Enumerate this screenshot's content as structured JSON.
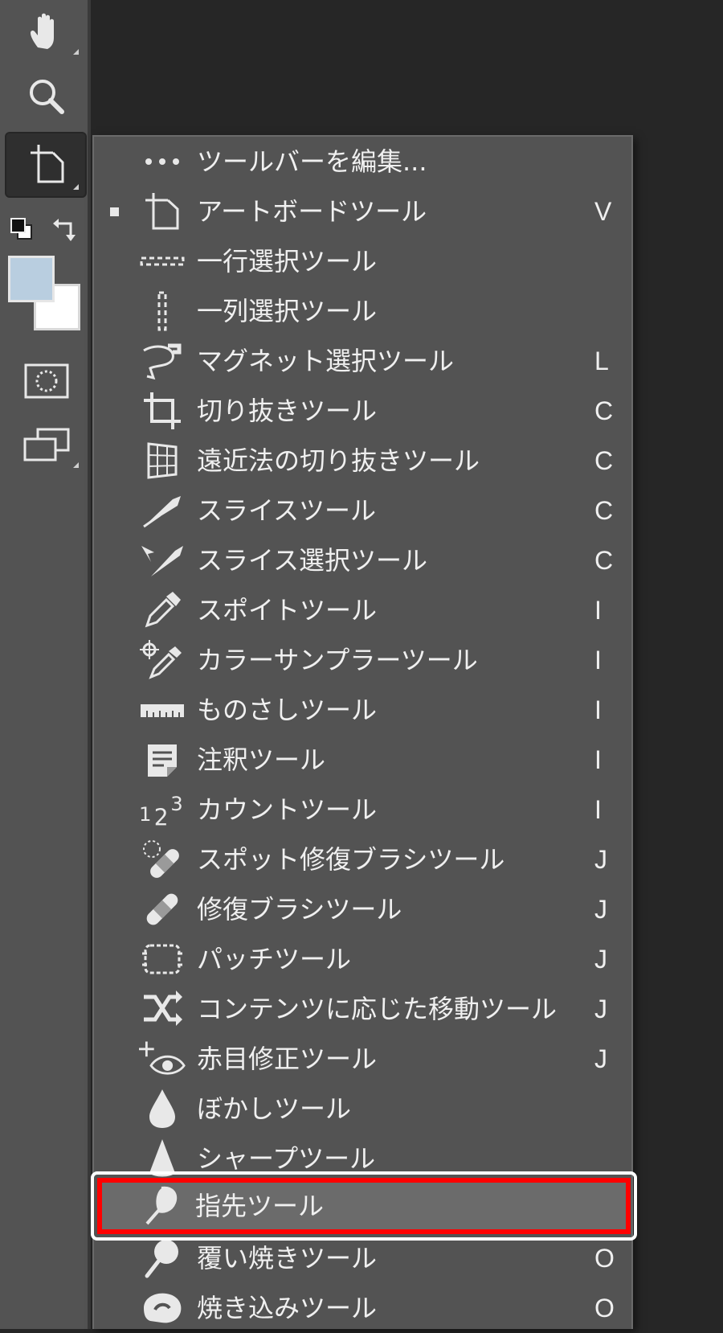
{
  "toolbar": {
    "tools": [
      {
        "name": "hand-tool",
        "icon": "hand-icon"
      },
      {
        "name": "zoom-tool",
        "icon": "magnifier-icon"
      },
      {
        "name": "artboard-tool",
        "icon": "artboard-icon",
        "active": true
      }
    ],
    "fg_color": "#b9cee0",
    "bg_color": "#ffffff"
  },
  "menu": {
    "items": [
      {
        "label": "ツールバーを編集...",
        "shortcut": "",
        "icon": "more-dots-icon",
        "selected": false
      },
      {
        "label": "アートボードツール",
        "shortcut": "V",
        "icon": "artboard-icon",
        "selected": true
      },
      {
        "label": "一行選択ツール",
        "shortcut": "",
        "icon": "single-row-marquee-icon",
        "selected": false
      },
      {
        "label": "一列選択ツール",
        "shortcut": "",
        "icon": "single-column-marquee-icon",
        "selected": false
      },
      {
        "label": "マグネット選択ツール",
        "shortcut": "L",
        "icon": "magnetic-lasso-icon",
        "selected": false
      },
      {
        "label": "切り抜きツール",
        "shortcut": "C",
        "icon": "crop-icon",
        "selected": false
      },
      {
        "label": "遠近法の切り抜きツール",
        "shortcut": "C",
        "icon": "perspective-crop-icon",
        "selected": false
      },
      {
        "label": "スライスツール",
        "shortcut": "C",
        "icon": "slice-icon",
        "selected": false
      },
      {
        "label": "スライス選択ツール",
        "shortcut": "C",
        "icon": "slice-select-icon",
        "selected": false
      },
      {
        "label": "スポイトツール",
        "shortcut": "I",
        "icon": "eyedropper-icon",
        "selected": false
      },
      {
        "label": "カラーサンプラーツール",
        "shortcut": "I",
        "icon": "color-sampler-icon",
        "selected": false
      },
      {
        "label": "ものさしツール",
        "shortcut": "I",
        "icon": "ruler-icon",
        "selected": false
      },
      {
        "label": "注釈ツール",
        "shortcut": "I",
        "icon": "note-icon",
        "selected": false
      },
      {
        "label": "カウントツール",
        "shortcut": "I",
        "icon": "count-icon",
        "selected": false
      },
      {
        "label": "スポット修復ブラシツール",
        "shortcut": "J",
        "icon": "spot-healing-icon",
        "selected": false
      },
      {
        "label": "修復ブラシツール",
        "shortcut": "J",
        "icon": "healing-brush-icon",
        "selected": false
      },
      {
        "label": "パッチツール",
        "shortcut": "J",
        "icon": "patch-icon",
        "selected": false
      },
      {
        "label": "コンテンツに応じた移動ツール",
        "shortcut": "J",
        "icon": "content-aware-move-icon",
        "selected": false
      },
      {
        "label": "赤目修正ツール",
        "shortcut": "J",
        "icon": "red-eye-icon",
        "selected": false
      },
      {
        "label": "ぼかしツール",
        "shortcut": "",
        "icon": "blur-drop-icon",
        "selected": false
      },
      {
        "label": "シャープツール",
        "shortcut": "",
        "icon": "sharpen-icon",
        "selected": false
      },
      {
        "label": "指先ツール",
        "shortcut": "",
        "icon": "smudge-icon",
        "selected": false,
        "highlighted": true
      },
      {
        "label": "覆い焼きツール",
        "shortcut": "O",
        "icon": "dodge-icon",
        "selected": false
      },
      {
        "label": "焼き込みツール",
        "shortcut": "O",
        "icon": "burn-icon",
        "selected": false
      }
    ]
  },
  "colors": {
    "panel": "#535353",
    "canvas": "#262626",
    "highlight_border": "#ff0000",
    "text": "#f0f0f0"
  }
}
